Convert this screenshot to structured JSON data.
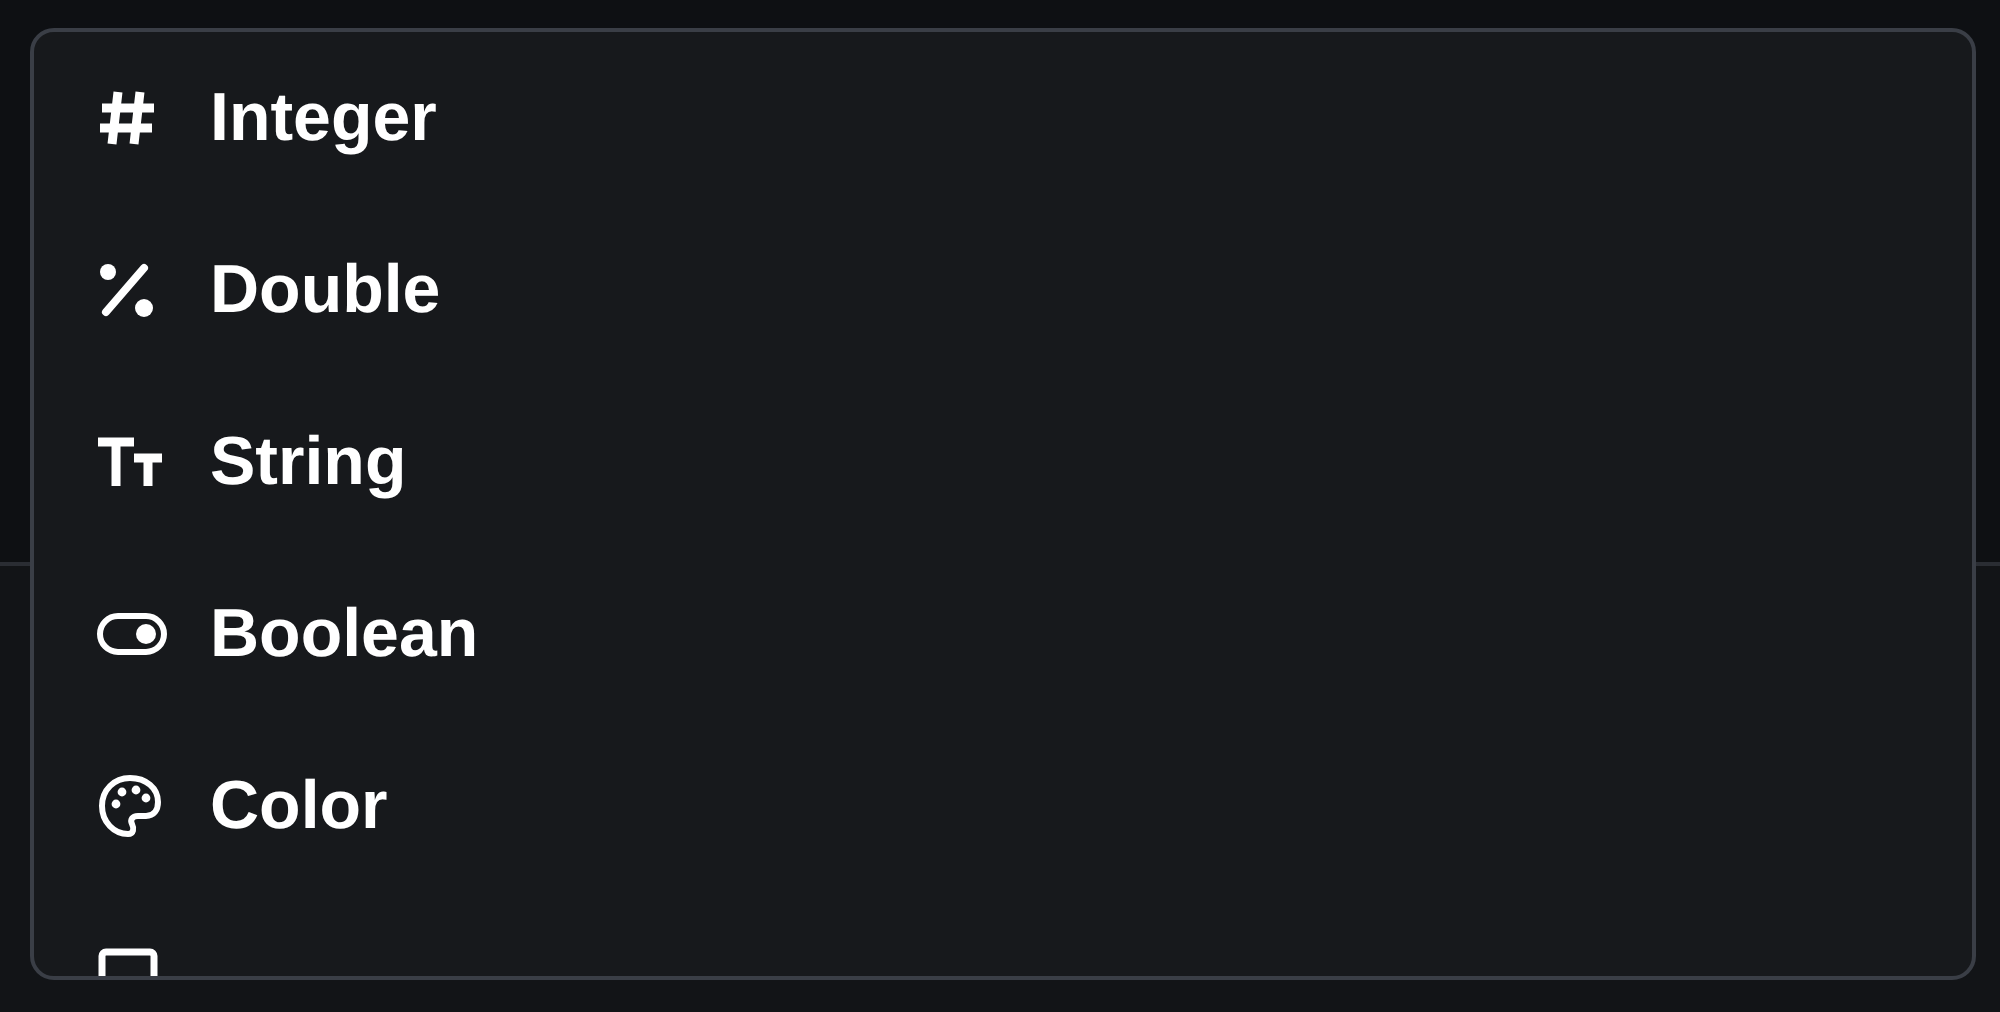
{
  "menu": {
    "items": [
      {
        "kind": "integer",
        "label": "Integer"
      },
      {
        "kind": "double",
        "label": "Double"
      },
      {
        "kind": "string",
        "label": "String"
      },
      {
        "kind": "boolean",
        "label": "Boolean"
      },
      {
        "kind": "color",
        "label": "Color"
      },
      {
        "kind": "image"
      }
    ]
  }
}
